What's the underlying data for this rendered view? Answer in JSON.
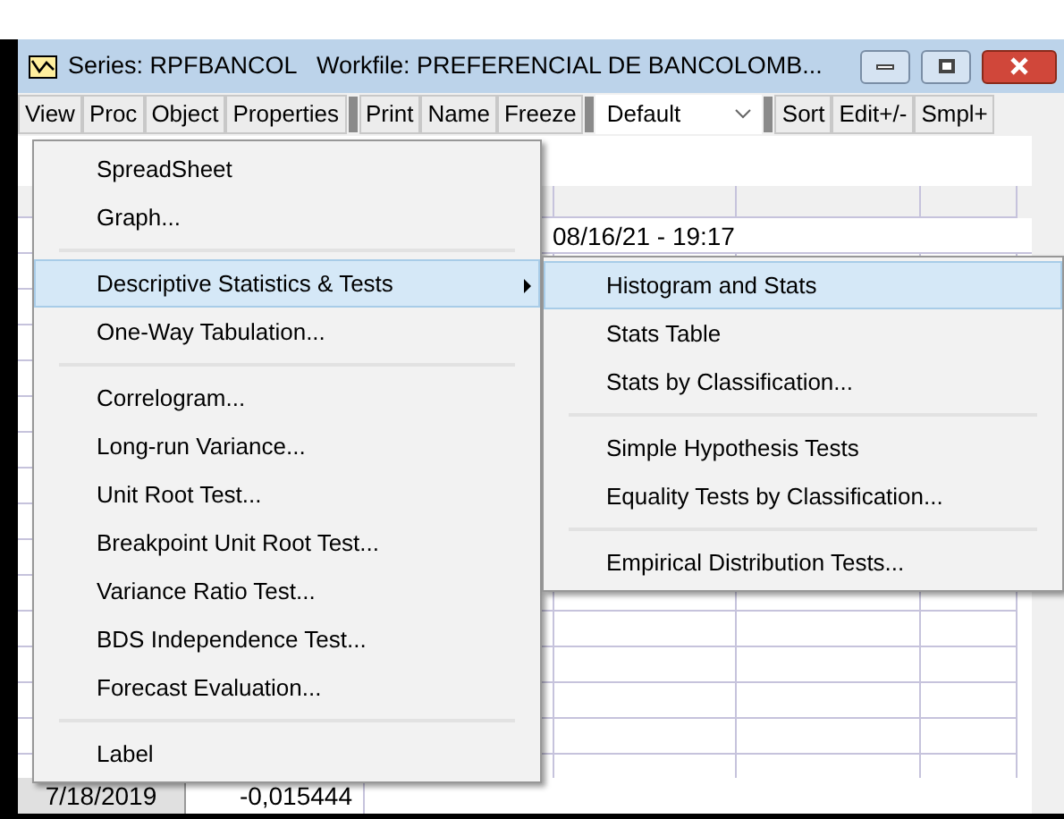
{
  "window": {
    "title": "Series: RPFBANCOL   Workfile: PREFERENCIAL DE BANCOLOMB..."
  },
  "toolbar": {
    "groups": [
      [
        "View",
        "Proc",
        "Object",
        "Properties"
      ],
      [
        "Print",
        "Name",
        "Freeze"
      ]
    ],
    "dropdown": {
      "value": "Default"
    },
    "buttons": [
      "Sort",
      "Edit+/-",
      "Smpl+"
    ]
  },
  "sheet": {
    "updated": "08/16/21 - 19:17",
    "last_row": {
      "obs": "7/18/2019",
      "value": "-0,015444"
    }
  },
  "menu": {
    "items": [
      {
        "kind": "item",
        "label": "SpreadSheet",
        "selected": false,
        "submenu": false
      },
      {
        "kind": "item",
        "label": "Graph...",
        "selected": false,
        "submenu": false
      },
      {
        "kind": "separator"
      },
      {
        "kind": "item",
        "label": "Descriptive Statistics & Tests",
        "selected": true,
        "submenu": true
      },
      {
        "kind": "item",
        "label": "One-Way Tabulation...",
        "selected": false,
        "submenu": false
      },
      {
        "kind": "separator"
      },
      {
        "kind": "item",
        "label": "Correlogram...",
        "selected": false,
        "submenu": false
      },
      {
        "kind": "item",
        "label": "Long-run Variance...",
        "selected": false,
        "submenu": false
      },
      {
        "kind": "item",
        "label": "Unit Root Test...",
        "selected": false,
        "submenu": false
      },
      {
        "kind": "item",
        "label": "Breakpoint Unit Root Test...",
        "selected": false,
        "submenu": false
      },
      {
        "kind": "item",
        "label": "Variance Ratio Test...",
        "selected": false,
        "submenu": false
      },
      {
        "kind": "item",
        "label": "BDS Independence Test...",
        "selected": false,
        "submenu": false
      },
      {
        "kind": "item",
        "label": "Forecast Evaluation...",
        "selected": false,
        "submenu": false
      },
      {
        "kind": "separator"
      },
      {
        "kind": "item",
        "label": "Label",
        "selected": false,
        "submenu": false
      }
    ]
  },
  "submenu": {
    "items": [
      {
        "kind": "item",
        "label": "Histogram and Stats",
        "selected": true
      },
      {
        "kind": "item",
        "label": "Stats Table",
        "selected": false
      },
      {
        "kind": "item",
        "label": "Stats by Classification...",
        "selected": false
      },
      {
        "kind": "separator"
      },
      {
        "kind": "item",
        "label": "Simple Hypothesis Tests",
        "selected": false
      },
      {
        "kind": "item",
        "label": "Equality Tests by Classification...",
        "selected": false
      },
      {
        "kind": "separator"
      },
      {
        "kind": "item",
        "label": "Empirical Distribution Tests...",
        "selected": false
      }
    ]
  }
}
